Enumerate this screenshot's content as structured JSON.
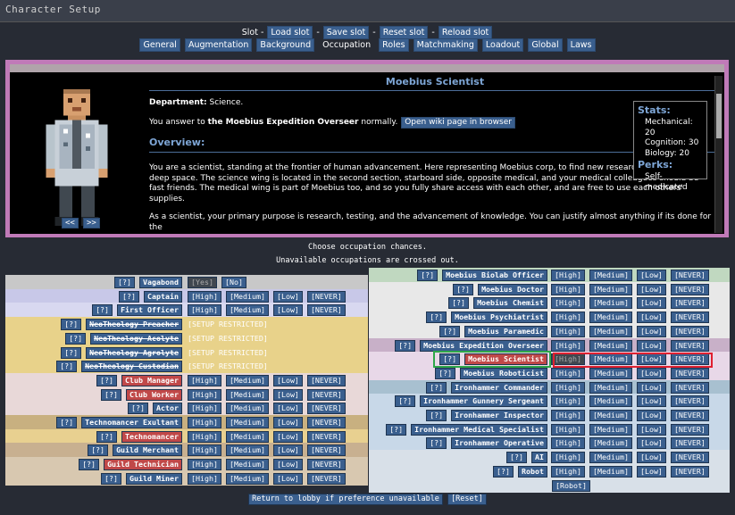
{
  "window_title": "Character Setup",
  "slot": {
    "label": "Slot -",
    "buttons": [
      "Load slot",
      "Save slot",
      "Reset slot",
      "Reload slot"
    ]
  },
  "tabs": [
    "General",
    "Augmentation",
    "Background",
    "Occupation",
    "Roles",
    "Matchmaking",
    "Loadout",
    "Global",
    "Laws"
  ],
  "active_tab": "Occupation",
  "occupation": {
    "title": "Moebius Scientist",
    "department_label": "Department:",
    "department_value": "Science.",
    "answer_prefix": "You answer to",
    "answer_to": "the Moebius Expedition Overseer",
    "answer_suffix": "normally.",
    "wiki_button": "Open wiki page in browser",
    "overview_heading": "Overview:",
    "overview_p1": "You are a scientist, standing at the frontier of human advancement. Here representing Moebius corp, to find new research opportunities in deep space. The science wing is located in the second section, starboard side, opposite medical, and your medical colleagues should be fast friends. The medical wing is part of Moebius too, and so you fully share access with each other, and are free to use each others' supplies.",
    "overview_p2": "As a scientist, your primary purpose is research, testing, and the advancement of knowledge. You can justify almost anything if its done for the",
    "prev_button": "<<",
    "next_button": ">>"
  },
  "stats": {
    "heading": "Stats:",
    "lines": [
      "Mechanical: 20",
      "Cognition: 30",
      "Biology: 20"
    ],
    "perks_heading": "Perks:",
    "perks": [
      "Self-medicated"
    ]
  },
  "notice_line1": "Choose occupation chances.",
  "notice_line2": "Unavailable occupations are crossed out.",
  "left_jobs": [
    {
      "name": "Vagabond",
      "kind": "yesno",
      "yes": "[Yes]",
      "no": "[No]",
      "bg": "#c8c8c8"
    },
    {
      "name": "Captain",
      "kind": "normal",
      "bg": "#c8c8e8"
    },
    {
      "name": "First Officer",
      "kind": "normal",
      "bg": "#d8d8f0"
    },
    {
      "name": "NeoTheology Preacher",
      "kind": "restricted",
      "bg": "#e8d28a"
    },
    {
      "name": "NeoTheology Acolyte",
      "kind": "restricted",
      "bg": "#e8d28a"
    },
    {
      "name": "NeoTheology Agrolyte",
      "kind": "restricted",
      "bg": "#e8d28a"
    },
    {
      "name": "NeoTheology Custodian",
      "kind": "restricted",
      "bg": "#e8d28a"
    },
    {
      "name": "Club Manager",
      "kind": "normal",
      "red": true,
      "bg": "#e8d8d8"
    },
    {
      "name": "Club Worker",
      "kind": "normal",
      "red": true,
      "bg": "#e8d8d8"
    },
    {
      "name": "Actor",
      "kind": "normal",
      "bg": "#e8d8d8"
    },
    {
      "name": "Technomancer Exultant",
      "kind": "normal",
      "bg": "#c8b080"
    },
    {
      "name": "Technomancer",
      "kind": "normal",
      "red": true,
      "bg": "#e8d090"
    },
    {
      "name": "Guild Merchant",
      "kind": "normal",
      "bg": "#c8b090"
    },
    {
      "name": "Guild Technician",
      "kind": "normal",
      "red": true,
      "bg": "#d8c8b0"
    },
    {
      "name": "Guild Miner",
      "kind": "normal",
      "bg": "#d8c8b0"
    }
  ],
  "right_jobs": [
    {
      "name": "Moebius Biolab Officer",
      "bg": "#c0d8c0"
    },
    {
      "name": "Moebius Doctor",
      "bg": "#e8e8e8"
    },
    {
      "name": "Moebius Chemist",
      "bg": "#e8e8e8"
    },
    {
      "name": "Moebius Psychiatrist",
      "bg": "#e8e8e8"
    },
    {
      "name": "Moebius Paramedic",
      "bg": "#e8e8e8"
    },
    {
      "name": "Moebius Expedition Overseer",
      "bg": "#c8b0c8"
    },
    {
      "name": "Moebius Scientist",
      "bg": "#e8d8e8",
      "red": true,
      "selected": "High"
    },
    {
      "name": "Moebius Roboticist",
      "bg": "#e8d8e8"
    },
    {
      "name": "Ironhammer Commander",
      "bg": "#a8c0d0"
    },
    {
      "name": "Ironhammer Gunnery Sergeant",
      "bg": "#c8d8e8"
    },
    {
      "name": "Ironhammer Inspector",
      "bg": "#c8d8e8"
    },
    {
      "name": "Ironhammer Medical Specialist",
      "bg": "#c8d8e8"
    },
    {
      "name": "Ironhammer Operative",
      "bg": "#c8d8e8"
    },
    {
      "name": "AI",
      "bg": "#d8e0e8"
    },
    {
      "name": "Robot",
      "bg": "#d8e0e8"
    }
  ],
  "robot_button": "[Robot]",
  "levels": {
    "high": "[High]",
    "medium": "[Medium]",
    "low": "[Low]",
    "never": "[NEVER]",
    "restricted": "[SETUP RESTRICTED]",
    "help": "[?]"
  },
  "footer": {
    "return_button": "Return to lobby if preference unavailable",
    "reset_button": "[Reset]"
  },
  "highlights": {
    "green": "#2ea84a",
    "red": "#e02030"
  }
}
